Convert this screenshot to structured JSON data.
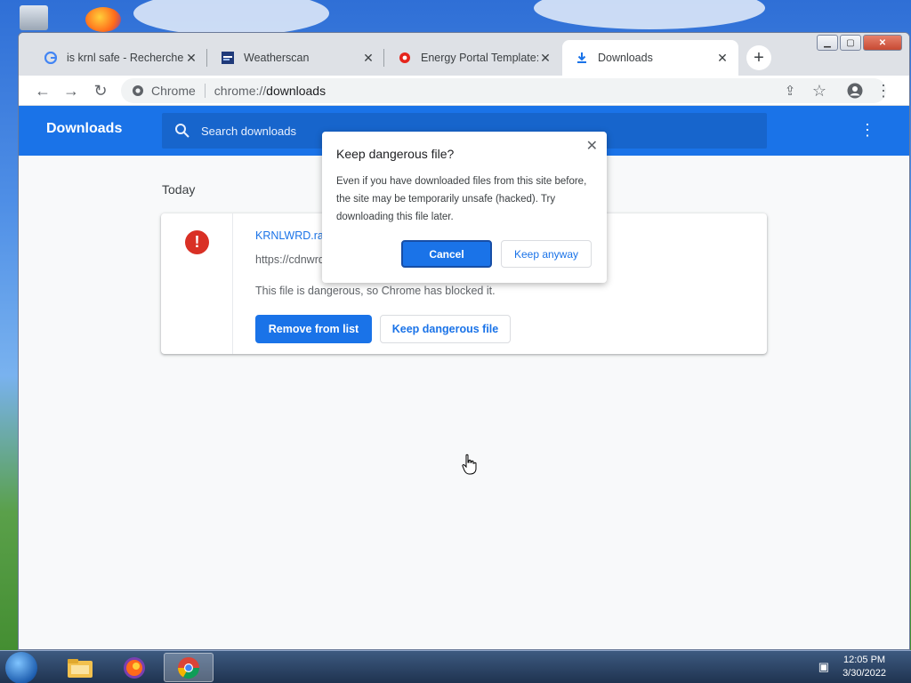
{
  "browser": {
    "tabs": [
      {
        "title": "is krnl safe - Recherche G",
        "icon": "google-icon",
        "active": false
      },
      {
        "title": "Weatherscan",
        "icon": "weatherscan-icon",
        "active": false
      },
      {
        "title": "Energy Portal Template: V",
        "icon": "opera-icon",
        "active": false
      },
      {
        "title": "Downloads",
        "icon": "download-icon",
        "active": true
      }
    ],
    "omnibox": {
      "chip": "Chrome",
      "url_prefix": "chrome://",
      "url_host": "downloads"
    }
  },
  "downloads_page": {
    "title": "Downloads",
    "search_placeholder": "Search downloads",
    "section_label": "Today",
    "item": {
      "file_name": "KRNLWRD.rar",
      "url": "https://cdnwrd2.com/r/54921/1648530755747/KRNLWRD.rar",
      "status": "This file is dangerous, so Chrome has blocked it.",
      "remove_label": "Remove from list",
      "keep_label": "Keep dangerous file"
    }
  },
  "dialog": {
    "title": "Keep dangerous file?",
    "body": "Even if you have downloaded files from this site before, the site may be temporarily unsafe (hacked). Try downloading this file later.",
    "cancel_label": "Cancel",
    "keep_label": "Keep anyway"
  },
  "taskbar": {
    "time": "12:05 PM",
    "date": "3/30/2022"
  },
  "colors": {
    "accent": "#1a73e8",
    "danger": "#d93025",
    "header_bg": "#1a73e8"
  }
}
